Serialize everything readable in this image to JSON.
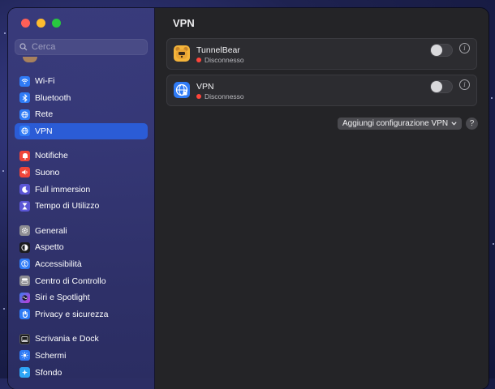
{
  "search": {
    "placeholder": "Cerca"
  },
  "sidebar": {
    "items": [
      {
        "label": "Wi-Fi",
        "icon": "wifi-icon",
        "color": "#2f7bf6"
      },
      {
        "label": "Bluetooth",
        "icon": "bluetooth-icon",
        "color": "#2f7bf6"
      },
      {
        "label": "Rete",
        "icon": "network-globe-icon",
        "color": "#2f7bf6"
      },
      {
        "label": "VPN",
        "icon": "vpn-globe-icon",
        "color": "#2f7bf6",
        "selected": true
      },
      {
        "label": "Notifiche",
        "icon": "bell-icon",
        "color": "#f0453a"
      },
      {
        "label": "Suono",
        "icon": "speaker-icon",
        "color": "#f0453a"
      },
      {
        "label": "Full immersion",
        "icon": "moon-icon",
        "color": "#5b56d6"
      },
      {
        "label": "Tempo di Utilizzo",
        "icon": "hourglass-icon",
        "color": "#5b56d6"
      },
      {
        "label": "Generali",
        "icon": "gear-icon",
        "color": "#8e8e93"
      },
      {
        "label": "Aspetto",
        "icon": "appearance-icon",
        "color": "#1c1c1e"
      },
      {
        "label": "Accessibilità",
        "icon": "accessibility-icon",
        "color": "#2f7bf6"
      },
      {
        "label": "Centro di Controllo",
        "icon": "control-center-icon",
        "color": "#8e8e93"
      },
      {
        "label": "Siri e Spotlight",
        "icon": "siri-icon",
        "color": "#7a3ad8"
      },
      {
        "label": "Privacy e sicurezza",
        "icon": "hand-icon",
        "color": "#2f7bf6"
      },
      {
        "label": "Scrivania e Dock",
        "icon": "dock-icon",
        "color": "#1c1c1e"
      },
      {
        "label": "Schermi",
        "icon": "display-sun-icon",
        "color": "#2f7bf6"
      },
      {
        "label": "Sfondo",
        "icon": "wallpaper-icon",
        "color": "#2fa6f6"
      }
    ]
  },
  "main": {
    "title": "VPN",
    "vpns": [
      {
        "name": "TunnelBear",
        "status": "Disconnesso",
        "icon": "tunnelbear-icon"
      },
      {
        "name": "VPN",
        "status": "Disconnesso",
        "icon": "vpn-globe-icon"
      }
    ],
    "add_label": "Aggiungi configurazione VPN",
    "help_label": "?"
  },
  "colors": {
    "accent": "#2b5cd6",
    "disconnected": "#ff453a"
  }
}
